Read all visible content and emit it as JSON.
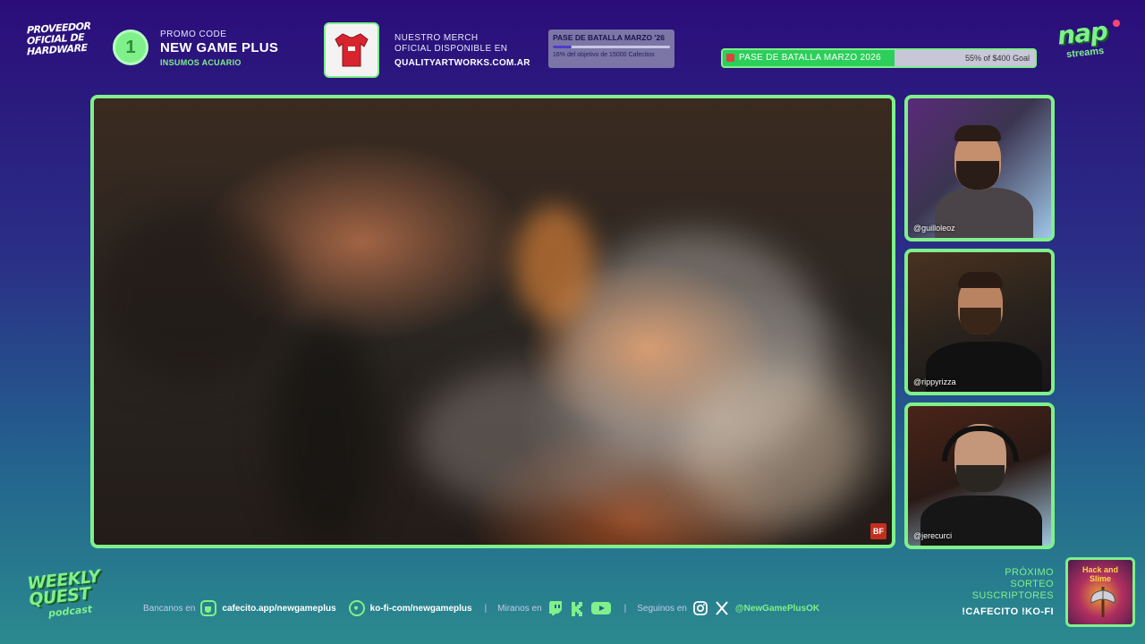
{
  "header": {
    "hardware_sponsor": "PROVEEDOR OFICIAL DE HARDWARE",
    "promo": {
      "label": "PROMO CODE",
      "code": "NEW GAME PLUS",
      "sponsor": "INSUMOS ACUARIO"
    },
    "merch": {
      "line1": "NUESTRO MERCH",
      "line2": "OFICIAL DISPONIBLE EN",
      "site": "QUALITYARTWORKS.COM.AR"
    },
    "mini_goal": {
      "title": "PASE DE BATALLA MARZO '26",
      "progress_percent": 16,
      "caption": "16% del objetivo de 15000 Cafecitos"
    },
    "goal_bar": {
      "title": "PASE DE BATALLA MARZO 2026",
      "progress_percent": 55,
      "caption": "55% of $400 Goal"
    },
    "brand": {
      "name": "nap",
      "sub": "streams"
    }
  },
  "main_video": {
    "badge": "BF"
  },
  "webcams": [
    {
      "handle": "@guilloleoz"
    },
    {
      "handle": "@rippyrizza"
    },
    {
      "handle": "@jerecurci"
    }
  ],
  "footer": {
    "show_logo": {
      "line1": "WEEKLY",
      "line2": "QUEST",
      "sub": "podcast"
    },
    "donate_label": "Bancanos en",
    "cafecito": "cafecito.app/newgameplus",
    "kofi": "ko-fi-com/newgameplus",
    "watch_label": "Miranos en",
    "divider": "|",
    "follow_label": "Seguinos en",
    "social_handle": "@NewGamePlusOK",
    "raffle": {
      "line1": "PRÓXIMO",
      "line2": "SORTEO",
      "line3": "SUSCRIPTORES",
      "line4": "!CAFECITO  !KO-FI"
    },
    "game_title": "Hack and Slime"
  },
  "colors": {
    "accent": "#7ff08a",
    "bg_top": "#2b0d7a",
    "bg_bottom": "#2a8a8e",
    "goal_fill": "#2ccf5a"
  }
}
